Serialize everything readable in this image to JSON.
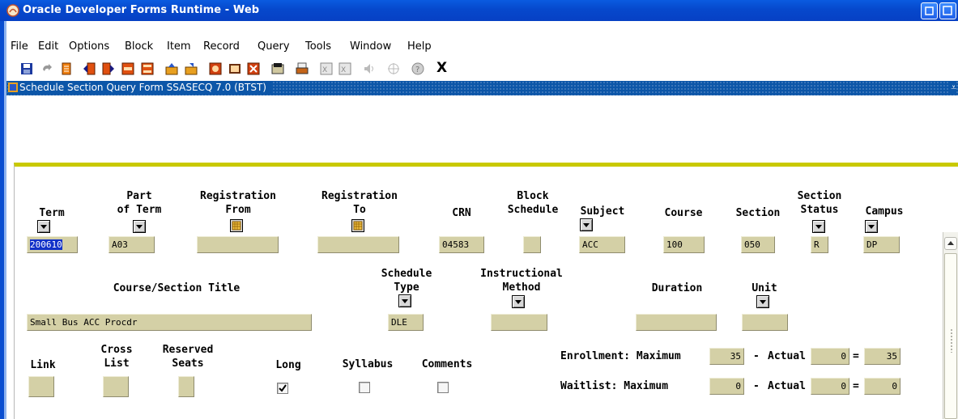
{
  "window": {
    "title": "Oracle Developer Forms Runtime - Web"
  },
  "menubar": {
    "items": [
      "File",
      "Edit",
      "Options",
      "Block",
      "Item",
      "Record",
      "Query",
      "Tools",
      "Window",
      "Help"
    ]
  },
  "toolbar": {
    "exit_label": "X",
    "icons": [
      "save-icon",
      "rollback-icon",
      "print-doc-icon",
      "previous-block-icon",
      "next-block-icon",
      "insert-record-icon",
      "remove-record-icon",
      "enter-query-icon",
      "execute-query-icon",
      "help-icon",
      "list-icon",
      "cancel-query-icon",
      "options-icon",
      "print-icon",
      "attach-icon",
      "detach-icon",
      "sound-icon",
      "target-icon",
      "question-icon"
    ]
  },
  "form": {
    "title": "Schedule Section Query Form  SSASECQ 7.0  (BTST)",
    "dock_glyph": "⩡"
  },
  "row1": {
    "labels": {
      "term": "Term",
      "part_of_term_1": "Part",
      "part_of_term_2": "of Term",
      "reg_from_1": "Registration",
      "reg_from_2": "From",
      "reg_to_1": "Registration",
      "reg_to_2": "To",
      "crn": "CRN",
      "block_1": "Block",
      "block_2": "Schedule",
      "subject": "Subject",
      "course": "Course",
      "section": "Section",
      "status_1": "Section",
      "status_2": "Status",
      "campus": "Campus"
    },
    "values": {
      "term": "200610",
      "part_of_term": "A03",
      "reg_from": "",
      "reg_to": "",
      "crn": "04583",
      "block_schedule": "",
      "subject": "ACC",
      "course": "100",
      "section": "050",
      "status": "R",
      "campus": "DP"
    }
  },
  "row2": {
    "labels": {
      "title": "Course/Section Title",
      "sched_1": "Schedule",
      "sched_2": "Type",
      "instr_1": "Instructional",
      "instr_2": "Method",
      "duration": "Duration",
      "unit": "Unit"
    },
    "values": {
      "title": "Small Bus ACC Procdr",
      "schedule_type": "DLE",
      "instructional_method": "",
      "duration": "",
      "unit": ""
    }
  },
  "row3": {
    "labels": {
      "link": "Link",
      "cross_1": "Cross",
      "cross_2": "List",
      "reserved_1": "Reserved",
      "reserved_2": "Seats",
      "long": "Long",
      "syllabus": "Syllabus",
      "comments": "Comments",
      "enrollment_max": "Enrollment: Maximum",
      "waitlist_max": "Waitlist: Maximum",
      "actual": "Actual",
      "minus": "-",
      "equals": "="
    },
    "values": {
      "link": "",
      "cross_list": "",
      "reserved_seats": "",
      "long_checked": true,
      "syllabus_checked": false,
      "comments_checked": false,
      "enroll_max": "35",
      "enroll_actual": "0",
      "enroll_remaining": "35",
      "wait_max": "0",
      "wait_actual": "0",
      "wait_remaining": "0"
    }
  }
}
